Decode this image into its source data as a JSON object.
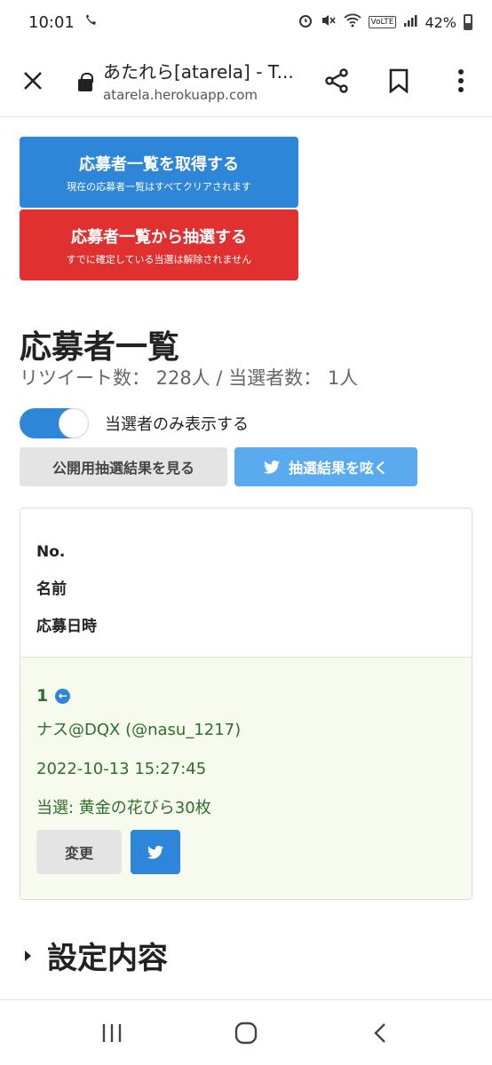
{
  "status": {
    "time": "10:01",
    "battery": "42%",
    "lte": "VoLTE"
  },
  "browser": {
    "page_title": "あたれら[atarela] - T...",
    "url": "atarela.herokuapp.com"
  },
  "actions": {
    "fetch_title": "応募者一覧を取得する",
    "fetch_sub": "現在の応募者一覧はすべてクリアされます",
    "draw_title": "応募者一覧から抽選する",
    "draw_sub": "すでに確定している当選は解除されません"
  },
  "list": {
    "title": "応募者一覧",
    "counts": "リツイート数： 228人 / 当選者数： 1人",
    "toggle_label": "当選者のみ表示する",
    "toggle_on": true,
    "public_results_label": "公開用抽選結果を見る",
    "tweet_results_label": "抽選結果を呟く",
    "headers": [
      "No.",
      "名前",
      "応募日時"
    ],
    "rows": [
      {
        "number": "1",
        "name": "ナス@DQX (@nasu_1217)",
        "date": "2022-10-13 15:27:45",
        "prize": "当選: 黄金の花びら30枚",
        "change_label": "変更"
      }
    ]
  },
  "settings": {
    "title": "設定内容"
  },
  "colors": {
    "blue": "#2e86d8",
    "red": "#e03030",
    "twitter": "#5aaaf0",
    "winner_bg": "#f7fbee",
    "winner_text": "#2d6e2a"
  }
}
